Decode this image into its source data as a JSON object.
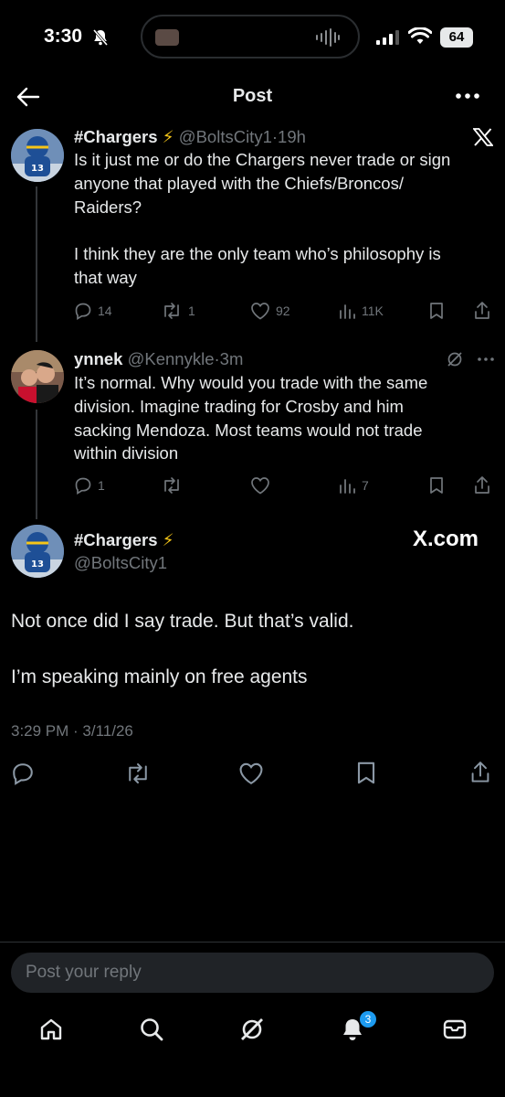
{
  "status_bar": {
    "time": "3:30",
    "battery": "64"
  },
  "header": {
    "title": "Post"
  },
  "tweets": [
    {
      "name": "#Chargers",
      "handle": "@BoltsCity1",
      "sep": "·",
      "time": "19h",
      "lines": [
        "Is it just me or do the Chargers never trade or sign",
        "anyone that played with the Chiefs/Broncos/",
        "Raiders?",
        "",
        "I think they are the only team who’s philosophy is",
        "that way"
      ],
      "actions": {
        "replies": "14",
        "reposts": "1",
        "likes": "92",
        "views": "11K"
      }
    },
    {
      "name": "ynnek",
      "handle": "@Kennykle",
      "sep": "·",
      "time": "3m",
      "lines": [
        "It’s normal. Why would you trade with the same",
        "division. Imagine trading for Crosby and him",
        "sacking Mendoza. Most teams would not trade",
        "within division"
      ],
      "actions": {
        "replies": "1",
        "reposts": "",
        "likes": "",
        "views": "7"
      }
    }
  ],
  "main_post": {
    "name": "#Chargers",
    "handle": "@BoltsCity1",
    "watermark": "X.com",
    "line1": "Not once did I say trade. But that’s valid.",
    "line2": "I’m speaking mainly on free agents",
    "timestamp": "3:29 PM · 3/11/26"
  },
  "reply_box": {
    "placeholder": "Post your reply"
  },
  "bottom_nav": {
    "notification_count": "3"
  },
  "colors": {
    "background": "#000000",
    "text": "#e7e9ea",
    "muted": "#71767b",
    "accent": "#1d9bf0",
    "bolt": "#f5c518"
  }
}
